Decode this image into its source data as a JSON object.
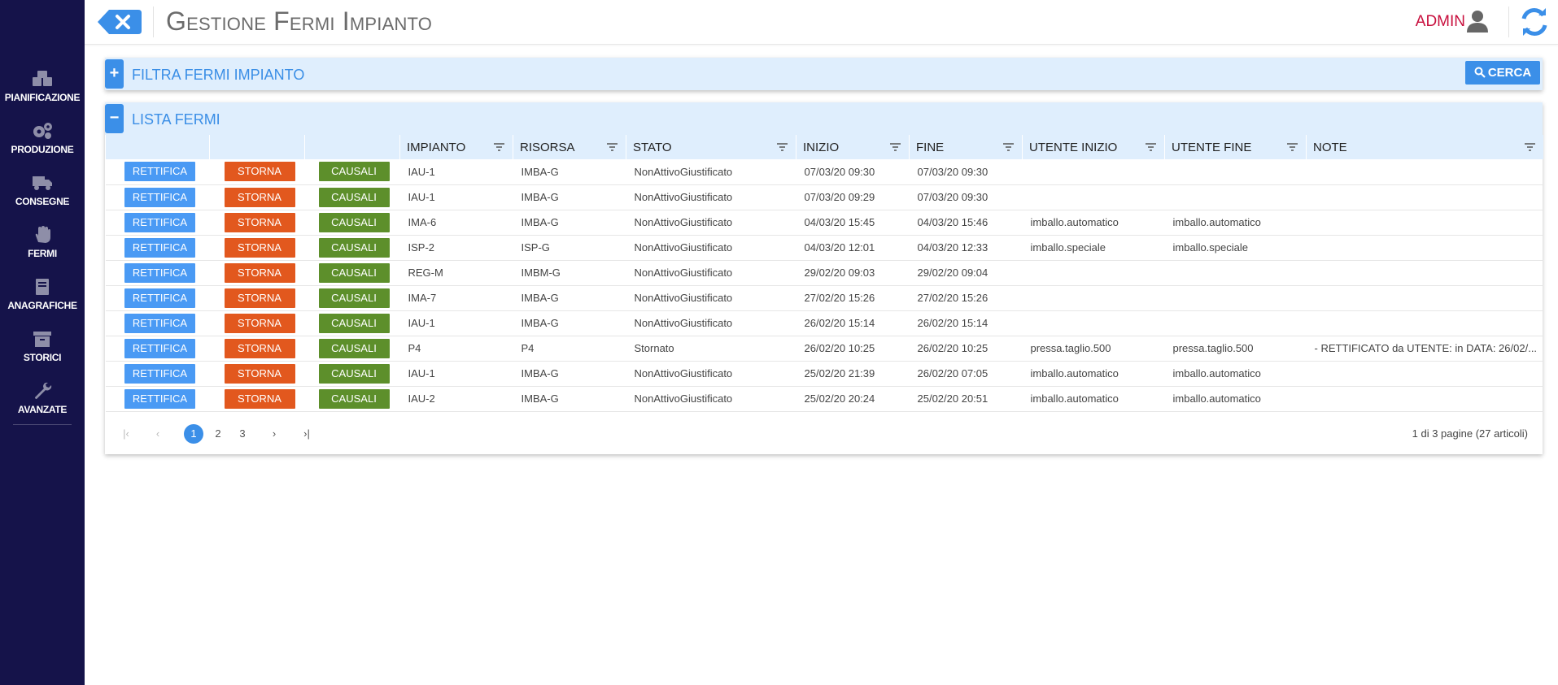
{
  "header": {
    "title": "Gestione Fermi Impianto",
    "user": "ADMIN"
  },
  "sidebar": {
    "items": [
      {
        "label": "PIANIFICAZIONE",
        "icon": "boxes-icon"
      },
      {
        "label": "PRODUZIONE",
        "icon": "gears-icon"
      },
      {
        "label": "CONSEGNE",
        "icon": "truck-icon"
      },
      {
        "label": "FERMI",
        "icon": "hand-icon"
      },
      {
        "label": "ANAGRAFICHE",
        "icon": "book-icon"
      },
      {
        "label": "STORICI",
        "icon": "archive-icon"
      },
      {
        "label": "AVANZATE",
        "icon": "wrench-icon"
      }
    ]
  },
  "filter_panel": {
    "toggle": "+",
    "title": "FILTRA FERMI IMPIANTO",
    "search_label": "CERCA"
  },
  "list_panel": {
    "toggle": "−",
    "title": "LISTA FERMI",
    "columns": [
      "IMPIANTO",
      "RISORSA",
      "STATO",
      "INIZIO",
      "FINE",
      "UTENTE INIZIO",
      "UTENTE FINE",
      "NOTE"
    ],
    "buttons": {
      "rettifica": "RETTIFICA",
      "storna": "STORNA",
      "causali": "CAUSALI"
    },
    "rows": [
      [
        "IAU-1",
        "IMBA-G",
        "NonAttivoGiustificato",
        "07/03/20 09:30",
        "07/03/20 09:30",
        "",
        "",
        ""
      ],
      [
        "IAU-1",
        "IMBA-G",
        "NonAttivoGiustificato",
        "07/03/20 09:29",
        "07/03/20 09:30",
        "",
        "",
        ""
      ],
      [
        "IMA-6",
        "IMBA-G",
        "NonAttivoGiustificato",
        "04/03/20 15:45",
        "04/03/20 15:46",
        "imballo.automatico",
        "imballo.automatico",
        ""
      ],
      [
        "ISP-2",
        "ISP-G",
        "NonAttivoGiustificato",
        "04/03/20 12:01",
        "04/03/20 12:33",
        "imballo.speciale",
        "imballo.speciale",
        ""
      ],
      [
        "REG-M",
        "IMBM-G",
        "NonAttivoGiustificato",
        "29/02/20 09:03",
        "29/02/20 09:04",
        "",
        "",
        ""
      ],
      [
        "IMA-7",
        "IMBA-G",
        "NonAttivoGiustificato",
        "27/02/20 15:26",
        "27/02/20 15:26",
        "",
        "",
        ""
      ],
      [
        "IAU-1",
        "IMBA-G",
        "NonAttivoGiustificato",
        "26/02/20 15:14",
        "26/02/20 15:14",
        "",
        "",
        ""
      ],
      [
        "P4",
        "P4",
        "Stornato",
        "26/02/20 10:25",
        "26/02/20 10:25",
        "pressa.taglio.500",
        "pressa.taglio.500",
        "- RETTIFICATO da UTENTE: in DATA: 26/02/..."
      ],
      [
        "IAU-1",
        "IMBA-G",
        "NonAttivoGiustificato",
        "25/02/20 21:39",
        "26/02/20 07:05",
        "imballo.automatico",
        "imballo.automatico",
        ""
      ],
      [
        "IAU-2",
        "IMBA-G",
        "NonAttivoGiustificato",
        "25/02/20 20:24",
        "25/02/20 20:51",
        "imballo.automatico",
        "imballo.automatico",
        ""
      ]
    ]
  },
  "pager": {
    "pages": [
      "1",
      "2",
      "3"
    ],
    "current": "1",
    "info": "1 di 3 pagine (27 articoli)"
  },
  "colors": {
    "sidebar": "#15134a",
    "accent": "#3b8fe8",
    "rettifica": "#4a9af4",
    "storna": "#e2581e",
    "causali": "#5d8f2b",
    "admin": "#c8103e"
  }
}
